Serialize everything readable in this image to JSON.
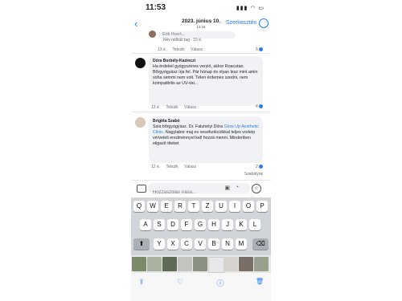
{
  "status": {
    "time": "11:53",
    "signal": "▮▮▮ ◠ ▭"
  },
  "header": {
    "back": "‹",
    "date": "2023. június 10.",
    "time": "13:34",
    "edit": "Szerkesztés",
    "more": "···"
  },
  "prev_comment": {
    "name_partial": "Erik Hvert...",
    "tag": "Név nélküli tag · 15 é.",
    "age": "13 é.",
    "like": "Tetszik",
    "reply": "Válasz",
    "react_count": "6"
  },
  "comments": [
    {
      "name": "Dóra Borbély-Kazinczi",
      "text": "Ha érdekel gyógyszeres verzió, akkor Roacutan. Bőrgyógyász írja fel. Pár hónap és olyan lesz mint amin soha semmi nem volt. Télen érdemes szedni, nem kompatibilis az UV-val...",
      "age": "13 é.",
      "like": "Tetszik",
      "reply": "Válasz",
      "react_count": "4"
    },
    {
      "name": "Brigitta Szabó",
      "text_before": "Szia bőrgyógyász. Dr. Faluhelyi Dóra ",
      "link": "Glow Up Aesthetic Clinic",
      "text_after": ". Nagylabor maj es vesefunkciókkal teljes vorkép  vérveteli eredménnyel kell hozzá menni. Minderiben eligazít titeket",
      "age": "12 é.",
      "like": "Tetszik",
      "reply": "Válasz",
      "react_count": "2"
    }
  ],
  "rules_link": "Szabályok",
  "input": {
    "placeholder": "Hozzászólás írása..."
  },
  "keyboard": {
    "row1": [
      "Q",
      "W",
      "E",
      "R",
      "T",
      "Z",
      "U",
      "I",
      "O",
      "P"
    ],
    "row2": [
      "A",
      "S",
      "D",
      "F",
      "G",
      "H",
      "J",
      "K",
      "L"
    ],
    "row3": [
      "Y",
      "X",
      "C",
      "V",
      "B",
      "N",
      "M"
    ],
    "shift": "⬆",
    "delete": "⌫"
  },
  "bottom": {
    "share": "⇪",
    "like": "♡",
    "info": "ⓘ",
    "delete": "🗑"
  },
  "colors": {
    "accent": "#2b7de9",
    "bubble": "#f0f2f5",
    "keyboard": "#d1d4d9"
  }
}
